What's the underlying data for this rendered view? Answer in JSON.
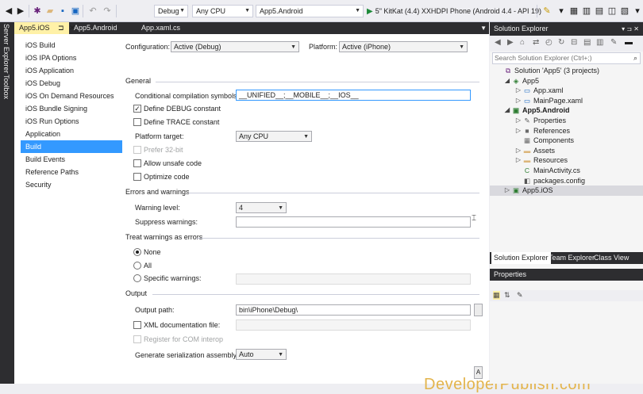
{
  "colors": {
    "accent": "#3399ff",
    "active_tab": "#fff1a7",
    "dark_chrome": "#2d2d30",
    "run_green": "#1e8a3a",
    "watermark": "#e3b44b"
  },
  "toolbar": {
    "icons": [
      "back-icon",
      "forward-icon",
      "new-project-icon",
      "open-icon",
      "save-icon",
      "save-all-icon",
      "undo-icon",
      "redo-icon",
      "run-icon",
      "attach-icon",
      "screenshot-icon",
      "device-log-icon",
      "more-icon"
    ],
    "configuration": "Debug",
    "platform": "Any CPU",
    "startup_project": "App5.Android",
    "run_label": "5\" KitKat (4.4) XXHDPI Phone (Android 4.4 - API 19)"
  },
  "side_strip": {
    "server_explorer": "Server Explorer",
    "toolbox": "Toolbox"
  },
  "doc_tabs": [
    {
      "label": "App5.iOS",
      "pin": "⊐",
      "close": "✕"
    },
    {
      "label": "App5.Android"
    },
    {
      "label": "App.xaml.cs"
    }
  ],
  "nav": {
    "items": [
      "iOS Build",
      "iOS IPA Options",
      "iOS Application",
      "iOS Debug",
      "iOS On Demand Resources",
      "iOS Bundle Signing",
      "iOS Run Options",
      "Application",
      "Build",
      "Build Events",
      "Reference Paths",
      "Security"
    ],
    "selected": "Build"
  },
  "config_bar": {
    "configuration_label": "Configuration:",
    "configuration_value": "Active (Debug)",
    "platform_label": "Platform:",
    "platform_value": "Active (iPhone)"
  },
  "general": {
    "heading": "General",
    "symbols_label": "Conditional compilation symbols:",
    "symbols_value": "__UNIFIED__;__MOBILE__;__IOS__",
    "define_debug": "Define DEBUG constant",
    "define_trace": "Define TRACE constant",
    "platform_target_label": "Platform target:",
    "platform_target_value": "Any CPU",
    "prefer32": "Prefer 32-bit",
    "unsafe": "Allow unsafe code",
    "optimize": "Optimize code"
  },
  "errors": {
    "heading": "Errors and warnings",
    "warning_level_label": "Warning level:",
    "warning_level_value": "4",
    "suppress_label": "Suppress warnings:",
    "suppress_value": ""
  },
  "treat": {
    "heading": "Treat warnings as errors",
    "none": "None",
    "all": "All",
    "specific": "Specific warnings:",
    "specific_value": ""
  },
  "output": {
    "heading": "Output",
    "path_label": "Output path:",
    "path_value": "bin\\iPhone\\Debug\\",
    "xml_doc": "XML documentation file:",
    "xml_doc_value": "",
    "register_com": "Register for COM interop",
    "serialization_label": "Generate serialization assembly:",
    "serialization_value": "Auto",
    "a_button": "A"
  },
  "watermark": "DeveloperPublish.com",
  "solution_explorer": {
    "title": "Solution Explorer",
    "title_tools": "▾ ⊐ ✕",
    "search_placeholder": "Search Solution Explorer (Ctrl+;)",
    "tree": [
      {
        "text": "Solution 'App5' (3 projects)",
        "level": 0,
        "expander": "",
        "icon": "solution-icon",
        "glyph": "⧉",
        "color": "#68217a",
        "bold": false
      },
      {
        "text": "App5",
        "level": 1,
        "expander": "◢",
        "icon": "csharp-project-icon",
        "glyph": "◈",
        "color": "#2e7d32",
        "bold": false
      },
      {
        "text": "App.xaml",
        "level": 2,
        "expander": "▷",
        "icon": "xaml-file-icon",
        "glyph": "▭",
        "color": "#1565c0",
        "bold": false
      },
      {
        "text": "MainPage.xaml",
        "level": 2,
        "expander": "▷",
        "icon": "xaml-file-icon",
        "glyph": "▭",
        "color": "#1565c0",
        "bold": false
      },
      {
        "text": "App5.Android",
        "level": 1,
        "expander": "◢",
        "icon": "android-project-icon",
        "glyph": "▣",
        "color": "#2e7d32",
        "bold": true
      },
      {
        "text": "Properties",
        "level": 2,
        "expander": "▷",
        "icon": "wrench-icon",
        "glyph": "✎",
        "color": "#555555",
        "bold": false
      },
      {
        "text": "References",
        "level": 2,
        "expander": "▷",
        "icon": "references-icon",
        "glyph": "■",
        "color": "#6a6a6a",
        "bold": false
      },
      {
        "text": "Components",
        "level": 2,
        "expander": "",
        "icon": "components-icon",
        "glyph": "▦",
        "color": "#6a6a6a",
        "bold": false
      },
      {
        "text": "Assets",
        "level": 2,
        "expander": "▷",
        "icon": "folder-icon",
        "glyph": "▬",
        "color": "#dcb67a",
        "bold": false
      },
      {
        "text": "Resources",
        "level": 2,
        "expander": "▷",
        "icon": "folder-icon",
        "glyph": "▬",
        "color": "#dcb67a",
        "bold": false
      },
      {
        "text": "MainActivity.cs",
        "level": 2,
        "expander": "",
        "icon": "csharp-file-icon",
        "glyph": "C",
        "color": "#2e7d32",
        "bold": false
      },
      {
        "text": "packages.config",
        "level": 2,
        "expander": "",
        "icon": "config-file-icon",
        "glyph": "◧",
        "color": "#555555",
        "bold": false
      },
      {
        "text": "App5.iOS",
        "level": 1,
        "expander": "▷",
        "icon": "ios-project-icon",
        "glyph": "▣",
        "color": "#2e7d32",
        "bold": false
      }
    ],
    "tree_selected": "App5.iOS",
    "tabs": [
      "Solution Explorer",
      "Team Explorer",
      "Class View"
    ]
  },
  "properties_pane": {
    "title": "Properties"
  }
}
